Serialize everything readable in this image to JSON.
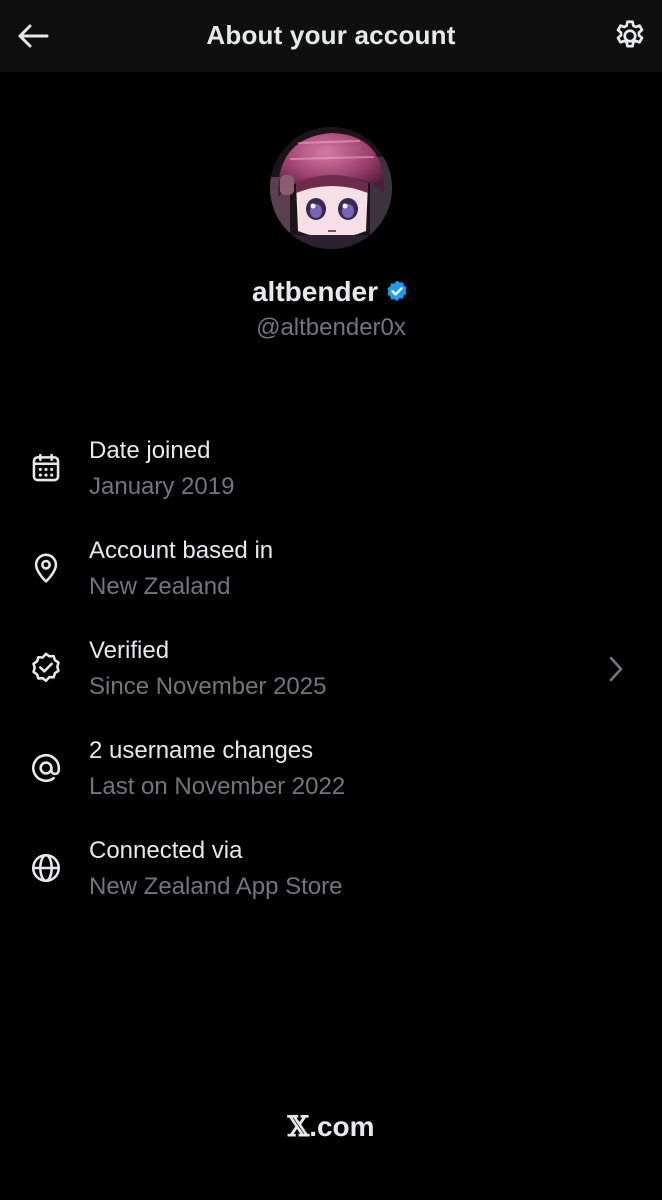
{
  "header": {
    "title": "About your account",
    "back_icon": "arrow-left-icon",
    "settings_icon": "gear-icon"
  },
  "profile": {
    "display_name": "altbender",
    "handle": "@altbender0x",
    "verified_badge_color": "#1d9bf0"
  },
  "info": {
    "date_joined": {
      "label": "Date joined",
      "value": "January 2019",
      "icon": "calendar-icon"
    },
    "based_in": {
      "label": "Account based in",
      "value": "New Zealand",
      "icon": "location-pin-icon"
    },
    "verified": {
      "label": "Verified",
      "value": "Since November 2025",
      "icon": "verified-badge-icon"
    },
    "username_changes": {
      "label": "2 username changes",
      "value": "Last on November 2022",
      "icon": "at-sign-icon"
    },
    "connected_via": {
      "label": "Connected via",
      "value": "New Zealand App Store",
      "icon": "globe-icon"
    }
  },
  "footer": {
    "logo_letter": "𝕏",
    "domain": ".com"
  },
  "colors": {
    "background": "#000000",
    "header_background": "#0f0f0f",
    "primary_text": "#e7e9ea",
    "secondary_text": "#71767b"
  }
}
